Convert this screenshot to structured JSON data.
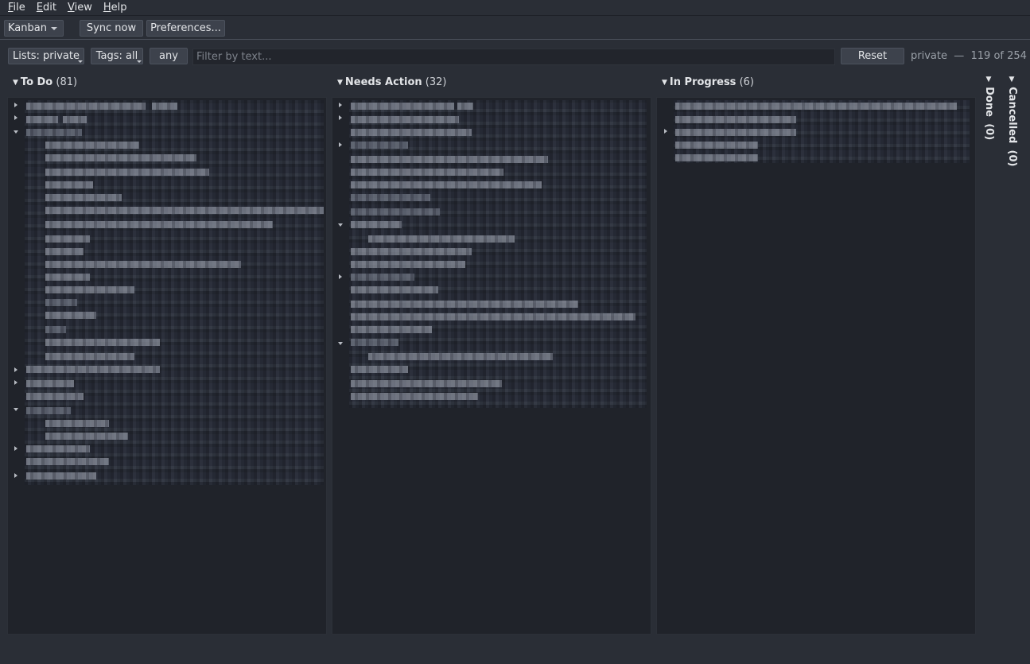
{
  "menu": {
    "items": [
      {
        "label": "File",
        "mnemonic": "F",
        "rest": "ile"
      },
      {
        "label": "Edit",
        "mnemonic": "E",
        "rest": "dit"
      },
      {
        "label": "View",
        "mnemonic": "V",
        "rest": "iew"
      },
      {
        "label": "Help",
        "mnemonic": "H",
        "rest": "elp"
      }
    ]
  },
  "toolbar": {
    "view_select": "Kanban",
    "sync_label": "Sync now",
    "preferences_label": "Preferences..."
  },
  "filter": {
    "lists_label": "Lists: private",
    "tags_label": "Tags: all",
    "match_label": "any",
    "search_placeholder": "Filter by text...",
    "search_value": "",
    "reset_label": "Reset",
    "status_list": "private",
    "status_sep": "—",
    "status_count": "119 of 254"
  },
  "columns": [
    {
      "name": "To Do",
      "count": "(81)",
      "collapsed": false
    },
    {
      "name": "Needs Action",
      "count": "(32)",
      "collapsed": false
    },
    {
      "name": "In Progress",
      "count": "(6)",
      "collapsed": false
    },
    {
      "name": "Done",
      "count": "(0)",
      "collapsed": true
    },
    {
      "name": "Cancelled",
      "count": "(0)",
      "collapsed": true
    }
  ],
  "colors": {
    "background": "#2a2e36",
    "column_body": "#20232a",
    "button": "#3d424c"
  }
}
